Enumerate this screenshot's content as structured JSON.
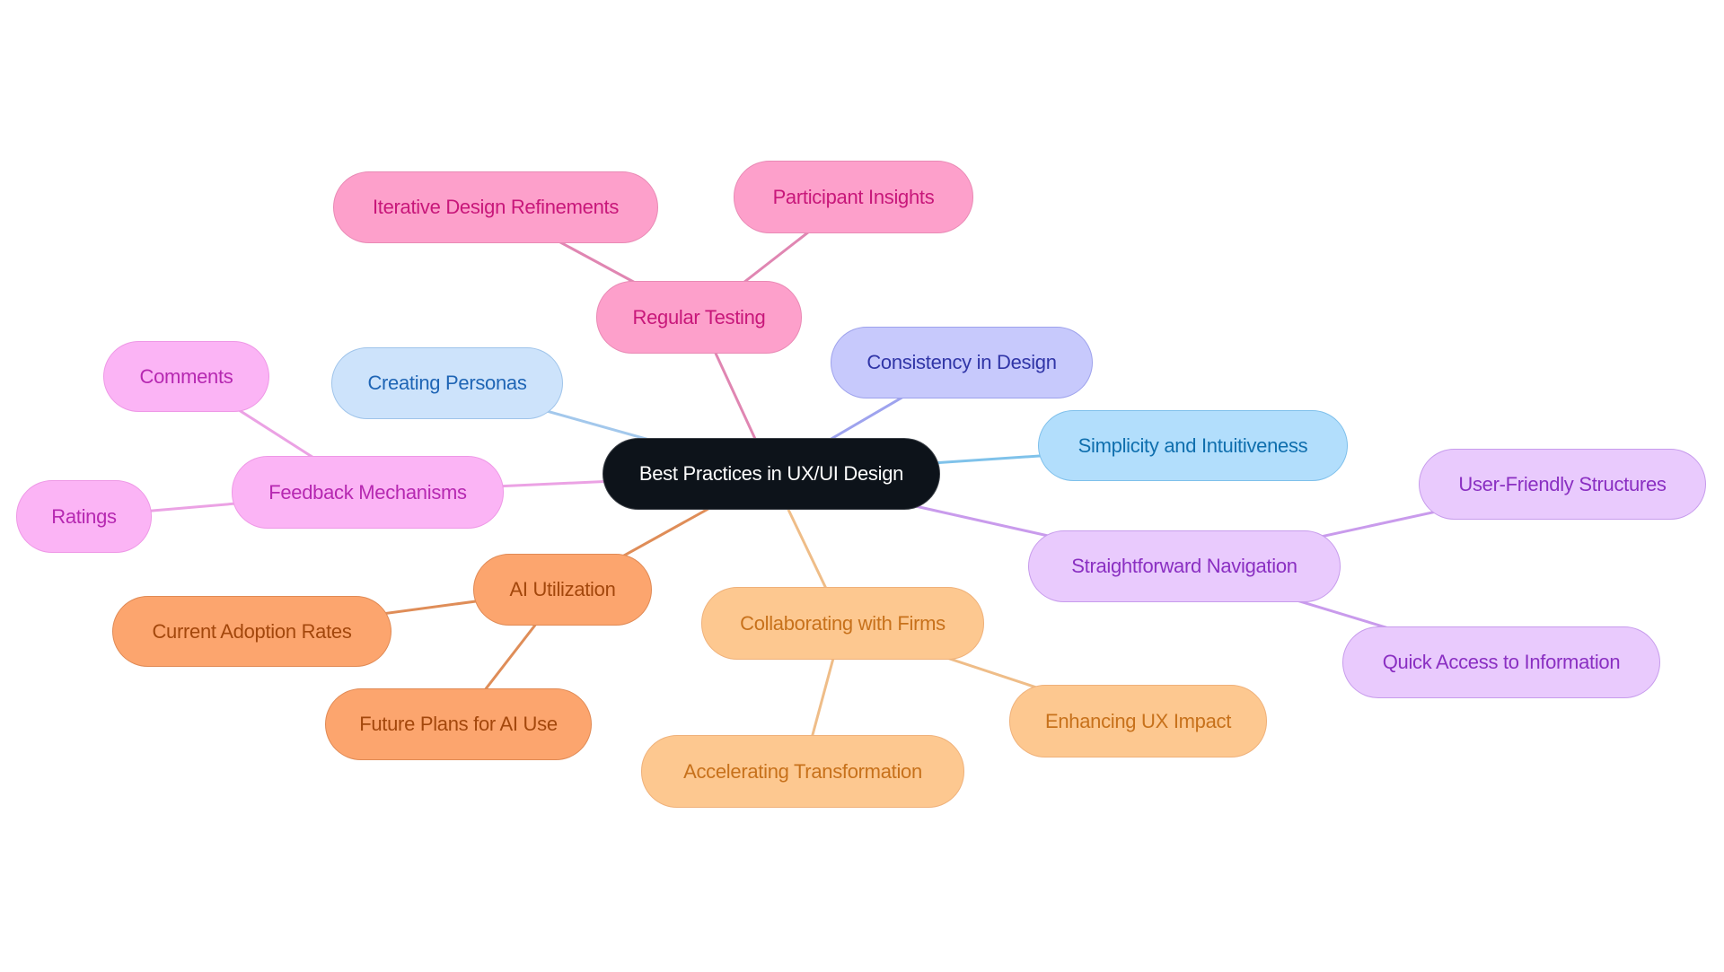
{
  "title": "Best Practices in UX/UI Design",
  "themes": {
    "root": {
      "fill": "#0d131a",
      "stroke": "#3a3f46",
      "text": "#ffffff",
      "edge": "#0d131a"
    },
    "pink": {
      "fill": "#fda0cb",
      "stroke": "#e98ab5",
      "text": "#c8177a",
      "edge": "#e086b2"
    },
    "blue": {
      "fill": "#cde3fb",
      "stroke": "#9fc4ea",
      "text": "#1f65b5",
      "edge": "#a3c8ec"
    },
    "indigo": {
      "fill": "#c7c9fc",
      "stroke": "#9ea2ec",
      "text": "#3035a7",
      "edge": "#9ea3ee"
    },
    "sky": {
      "fill": "#b2defc",
      "stroke": "#7fc0eb",
      "text": "#0f6fae",
      "edge": "#7fc2ea"
    },
    "violet": {
      "fill": "#e9cafd",
      "stroke": "#c79cec",
      "text": "#8a2fc2",
      "edge": "#c99bec"
    },
    "magenta": {
      "fill": "#fbb4f5",
      "stroke": "#ee98e6",
      "text": "#b628b1",
      "edge": "#eba2e4"
    },
    "orange": {
      "fill": "#fca56e",
      "stroke": "#e08a55",
      "text": "#a3470c",
      "edge": "#df8d58"
    },
    "peach": {
      "fill": "#fdc890",
      "stroke": "#efb17a",
      "text": "#c7711b",
      "edge": "#efbd88"
    }
  },
  "nodes": [
    {
      "id": "root",
      "label": "Best Practices in UX/UI Design",
      "theme": "root",
      "parent": null
    },
    {
      "id": "regular-testing",
      "label": "Regular Testing",
      "theme": "pink",
      "parent": "root"
    },
    {
      "id": "iterative-design-refinements",
      "label": "Iterative Design Refinements",
      "theme": "pink",
      "parent": "regular-testing"
    },
    {
      "id": "participant-insights",
      "label": "Participant Insights",
      "theme": "pink",
      "parent": "regular-testing"
    },
    {
      "id": "creating-personas",
      "label": "Creating Personas",
      "theme": "blue",
      "parent": "root"
    },
    {
      "id": "consistency-in-design",
      "label": "Consistency in Design",
      "theme": "indigo",
      "parent": "root"
    },
    {
      "id": "simplicity-and-intuitiveness",
      "label": "Simplicity and Intuitiveness",
      "theme": "sky",
      "parent": "root"
    },
    {
      "id": "straightforward-navigation",
      "label": "Straightforward Navigation",
      "theme": "violet",
      "parent": "root"
    },
    {
      "id": "user-friendly-structures",
      "label": "User-Friendly Structures",
      "theme": "violet",
      "parent": "straightforward-navigation"
    },
    {
      "id": "quick-access-to-information",
      "label": "Quick Access to Information",
      "theme": "violet",
      "parent": "straightforward-navigation"
    },
    {
      "id": "feedback-mechanisms",
      "label": "Feedback Mechanisms",
      "theme": "magenta",
      "parent": "root"
    },
    {
      "id": "comments",
      "label": "Comments",
      "theme": "magenta",
      "parent": "feedback-mechanisms"
    },
    {
      "id": "ratings",
      "label": "Ratings",
      "theme": "magenta",
      "parent": "feedback-mechanisms"
    },
    {
      "id": "ai-utilization",
      "label": "AI Utilization",
      "theme": "orange",
      "parent": "root"
    },
    {
      "id": "current-adoption-rates",
      "label": "Current Adoption Rates",
      "theme": "orange",
      "parent": "ai-utilization"
    },
    {
      "id": "future-plans-for-ai-use",
      "label": "Future Plans for AI Use",
      "theme": "orange",
      "parent": "ai-utilization"
    },
    {
      "id": "collaborating-with-firms",
      "label": "Collaborating with Firms",
      "theme": "peach",
      "parent": "root"
    },
    {
      "id": "enhancing-ux-impact",
      "label": "Enhancing UX Impact",
      "theme": "peach",
      "parent": "collaborating-with-firms"
    },
    {
      "id": "accelerating-transformation",
      "label": "Accelerating Transformation",
      "theme": "peach",
      "parent": "collaborating-with-firms"
    }
  ]
}
